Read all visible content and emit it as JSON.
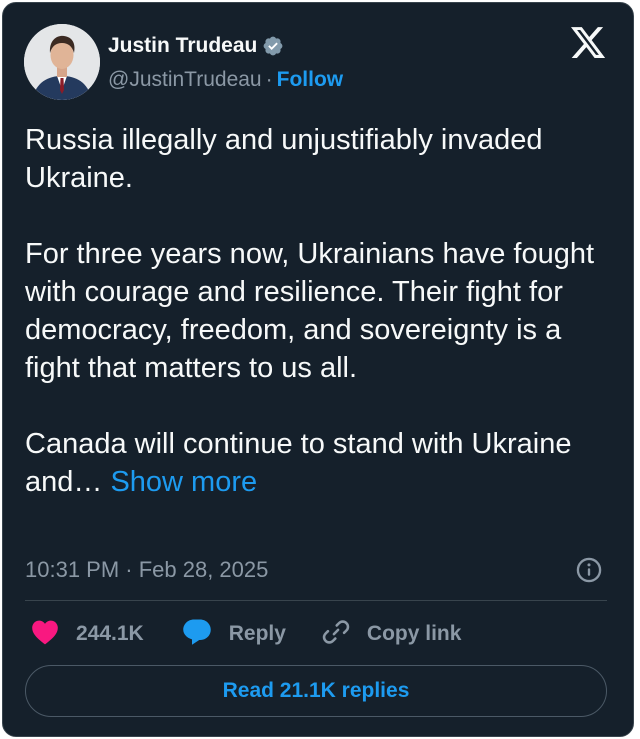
{
  "tweet": {
    "author": {
      "display_name": "Justin Trudeau",
      "handle": "@JustinTrudeau",
      "verified": true,
      "verified_badge_color": "#829aab"
    },
    "follow_label": "Follow",
    "separator": "·",
    "text_paragraphs": [
      "Russia illegally and unjustifiably invaded Ukraine.",
      "For three years now, Ukrainians have fought with courage and resilience. Their fight for democracy, freedom, and sovereignty is a fight that matters to us all.",
      "Canada will continue to stand with Ukraine and… "
    ],
    "show_more_label": "Show more",
    "timestamp": "10:31 PM · Feb 28, 2025",
    "actions": {
      "like_count": "244.1K",
      "reply_label": "Reply",
      "copy_link_label": "Copy link"
    },
    "read_replies_label": "Read 21.1K replies"
  },
  "icons": {
    "brand": "x-logo-icon",
    "verified": "verified-badge-icon",
    "info": "info-icon",
    "like": "heart-icon",
    "reply": "reply-bubble-icon",
    "copy_link": "link-icon"
  },
  "colors": {
    "background": "#15202b",
    "text": "#f7f9f9",
    "secondary_text": "#8b98a5",
    "accent": "#1d9bf0",
    "like": "#f91880",
    "border": "#38444d"
  }
}
